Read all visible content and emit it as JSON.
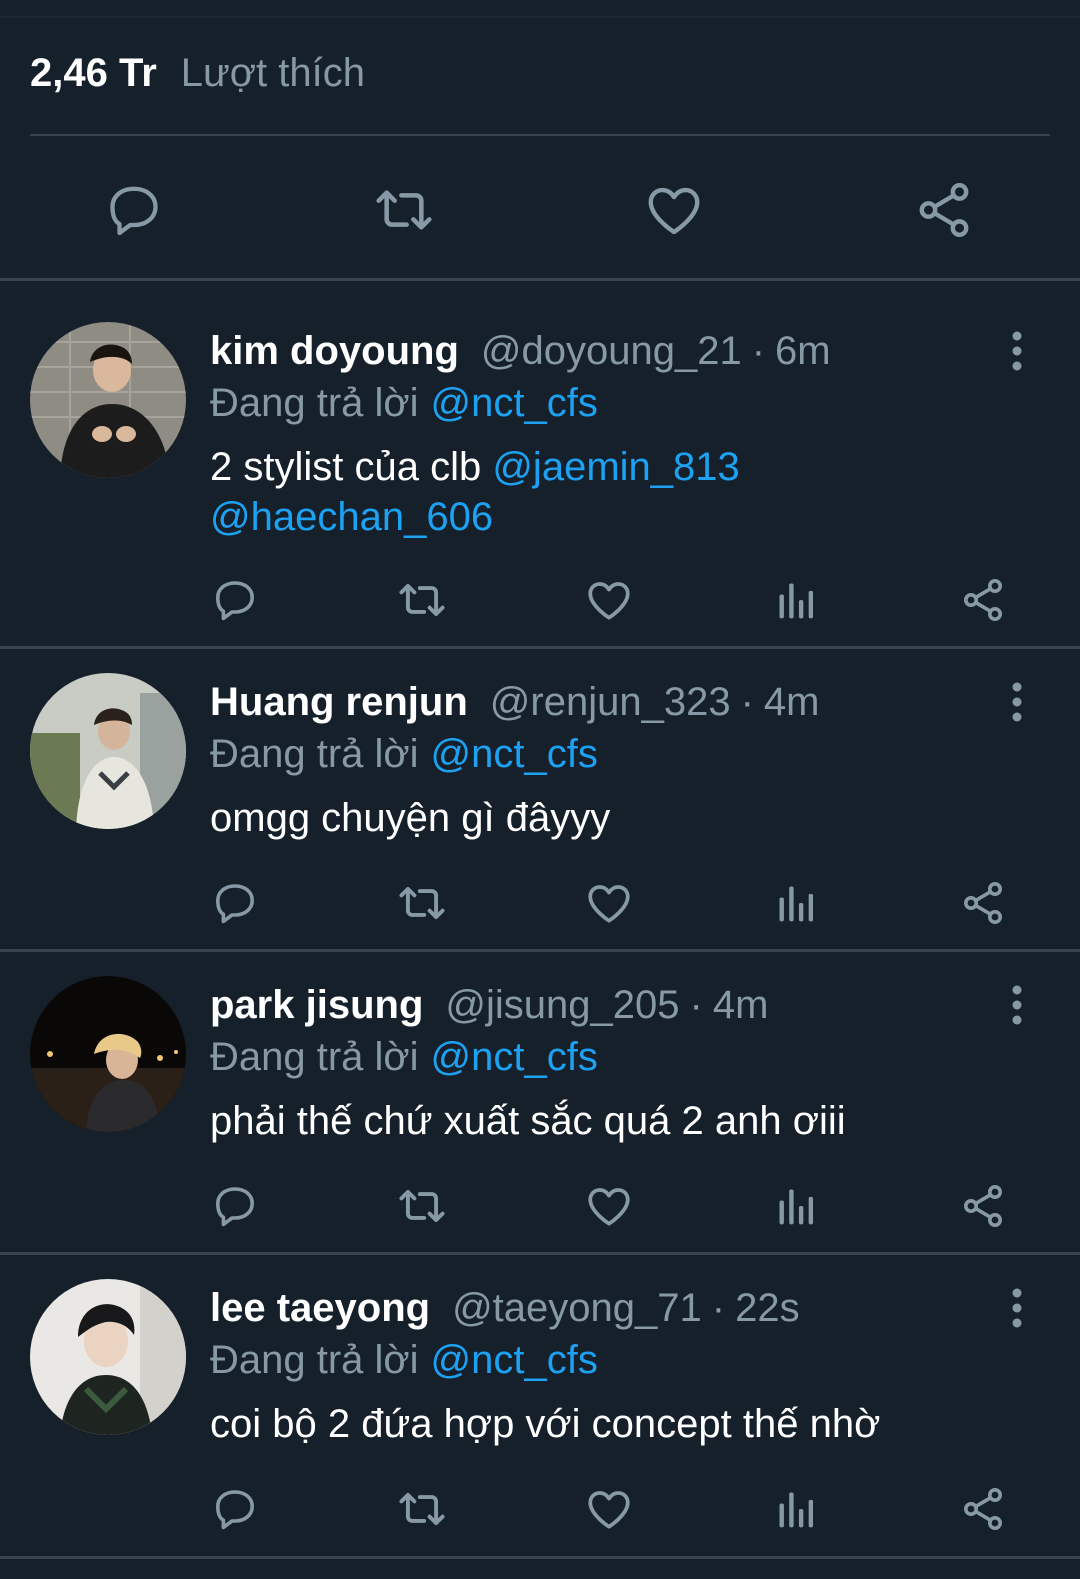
{
  "tweet_stats": {
    "likes_count": "2,46 Tr",
    "likes_label": "Lượt thích"
  },
  "main_actions": [
    "reply-icon",
    "retweet-icon",
    "like-icon",
    "share-icon"
  ],
  "reply_row_icons": [
    "reply-icon",
    "retweet-icon",
    "like-icon",
    "analytics-icon",
    "share-icon"
  ],
  "colors": {
    "background": "#15202b",
    "secondary_text": "#8899a6",
    "link": "#1da1f2",
    "divider": "#38444d"
  },
  "replies": [
    {
      "name": "kim doyoung",
      "handle": "@doyoung_21",
      "dot": "·",
      "time": "6m",
      "replying_label": "Đang trả lời",
      "replying_to": "@nct_cfs",
      "text_prefix": "2 stylist của clb ",
      "mention_1": "@jaemin_813",
      "mention_2": "@haechan_606"
    },
    {
      "name": "Huang renjun",
      "handle": "@renjun_323",
      "dot": "·",
      "time": "4m",
      "replying_label": "Đang trả lời",
      "replying_to": "@nct_cfs",
      "text": "omgg chuyện gì đâyyy"
    },
    {
      "name": "park jisung",
      "handle": "@jisung_205",
      "dot": "·",
      "time": "4m",
      "replying_label": "Đang trả lời",
      "replying_to": "@nct_cfs",
      "text": "phải thế chứ xuất sắc quá 2 anh ơiii"
    },
    {
      "name": "lee taeyong",
      "handle": "@taeyong_71",
      "dot": "·",
      "time": "22s",
      "replying_label": "Đang trả lời",
      "replying_to": "@nct_cfs",
      "text": "coi bộ 2 đứa hợp với concept thế nhờ"
    }
  ]
}
